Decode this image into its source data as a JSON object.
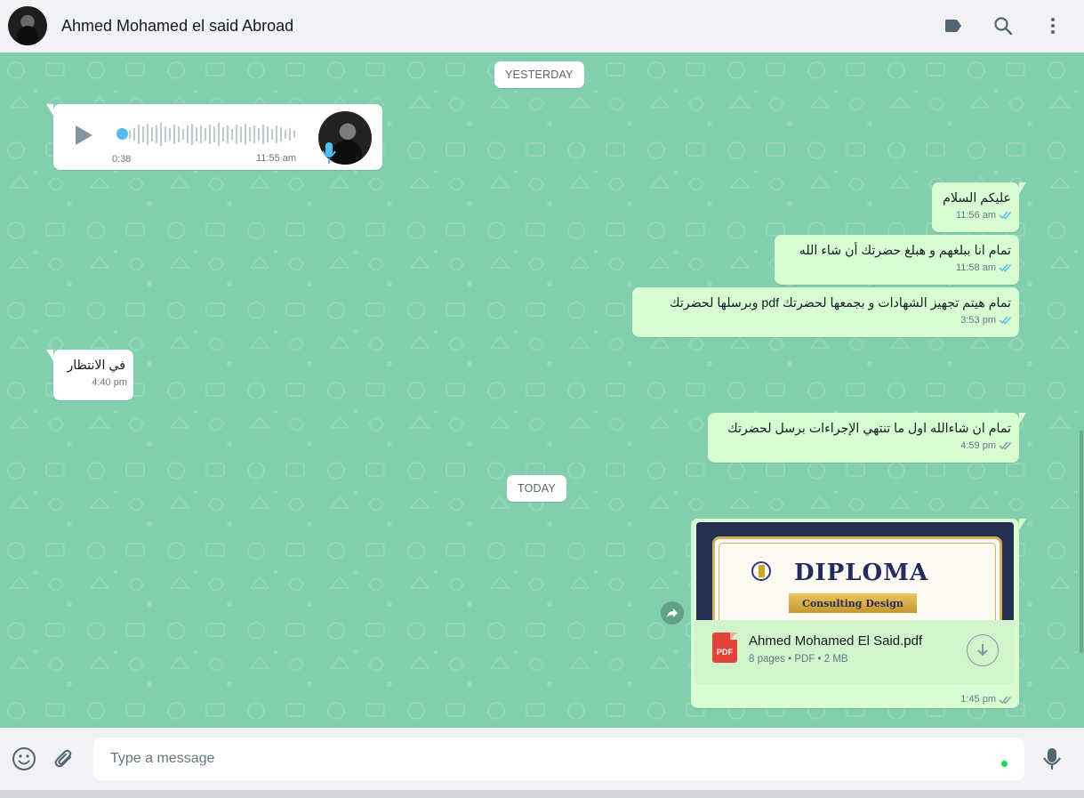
{
  "header": {
    "contact_name": "Ahmed Mohamed el said Abroad",
    "icons": [
      "label-icon",
      "search-icon",
      "menu-icon"
    ]
  },
  "dates": {
    "yesterday": "YESTERDAY",
    "today": "TODAY"
  },
  "voice_note": {
    "duration": "0:38",
    "time": "11:55 am"
  },
  "messages": [
    {
      "direction": "out",
      "text": "عليكم السلام",
      "time": "11:56 am",
      "status": "read"
    },
    {
      "direction": "out",
      "text": "تمام انا ببلغهم و هبلغ حضرتك أن شاء الله",
      "time": "11:58 am",
      "status": "read"
    },
    {
      "direction": "out",
      "text": "تمام هيتم تجهيز الشهادات و بجمعها لحضرتك pdf وبرسلها لحضرتك",
      "time": "3:53 pm",
      "status": "read"
    },
    {
      "direction": "in",
      "text": "في الانتظار",
      "time": "4:40 pm"
    },
    {
      "direction": "out",
      "text": "تمام ان شاءالله اول ما تنتهي الإجراءات برسل لحضرتك",
      "time": "4:59 pm",
      "status": "delivered"
    }
  ],
  "document": {
    "preview_title": "DIPLOMA",
    "preview_ribbon": "Consulting Design",
    "file_name": "Ahmed Mohamed El Said.pdf",
    "file_meta": "8 pages • PDF • 2 MB",
    "file_type_badge": "PDF",
    "time": "1:45 pm",
    "status": "delivered"
  },
  "composer": {
    "placeholder": "Type a message"
  },
  "colors": {
    "chat_bg": "#81cfac",
    "outgoing_bubble": "#d9fdd3",
    "incoming_bubble": "#ffffff",
    "read_tick": "#53bdeb",
    "unread_tick": "#8696a0"
  }
}
